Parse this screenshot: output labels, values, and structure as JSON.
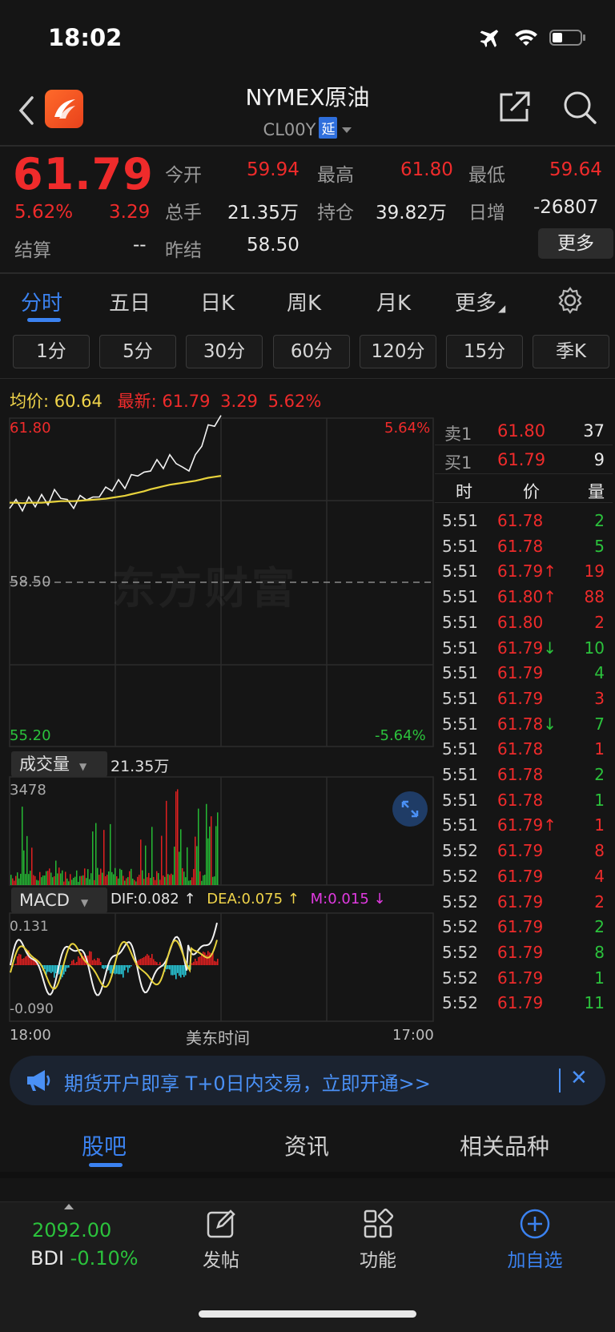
{
  "status": {
    "time": "18:02"
  },
  "header": {
    "title": "NYMEX原油",
    "code": "CL00Y",
    "badge": "延"
  },
  "quote": {
    "price": "61.79",
    "change_pct": "5.62%",
    "change": "3.29",
    "settle_label": "结算",
    "settle_value": "--",
    "fields": [
      {
        "label": "今开",
        "value": "59.94",
        "color": "red"
      },
      {
        "label": "最高",
        "value": "61.80",
        "color": "red"
      },
      {
        "label": "最低",
        "value": "59.64",
        "color": "red"
      },
      {
        "label": "总手",
        "value": "21.35万",
        "color": "white"
      },
      {
        "label": "持仓",
        "value": "39.82万",
        "color": "white"
      },
      {
        "label": "日增",
        "value": "-26807",
        "color": "white"
      },
      {
        "label": "昨结",
        "value": "58.50",
        "color": "white"
      }
    ],
    "more_label": "更多"
  },
  "main_tabs": [
    "分时",
    "五日",
    "日K",
    "周K",
    "月K",
    "更多"
  ],
  "period_tabs": [
    "1分",
    "5分",
    "30分",
    "60分",
    "120分",
    "15分",
    "季K"
  ],
  "avg_row": {
    "avg_label": "均价:",
    "avg_value": "60.64",
    "latest_label": "最新:",
    "latest_value": "61.79",
    "latest_change": "3.29",
    "latest_pct": "5.62%"
  },
  "chart": {
    "price_top": "61.80",
    "price_mid": "58.50",
    "price_bot": "55.20",
    "pct_top": "5.64%",
    "pct_bot": "-5.64%",
    "watermark": "东方财富",
    "volume_label": "成交量",
    "volume_total": "21.35万",
    "volume_max": "3478",
    "macd_label": "MACD",
    "dif": "DIF:0.082 ↑",
    "dea": "DEA:0.075 ↑",
    "m": "M:0.015 ↓",
    "macd_max": "0.131",
    "macd_min": "-0.090",
    "x_left": "18:00",
    "x_mid": "美东时间",
    "x_right": "17:00"
  },
  "chart_data": {
    "type": "line",
    "xlabel": "美东时间",
    "ylim": [
      55.2,
      61.8
    ],
    "series": [
      {
        "values": [
          60.05,
          60.1,
          60.0,
          60.15,
          60.08,
          60.2,
          60.12,
          60.3,
          60.25,
          60.1,
          60.05,
          60.18,
          60.22,
          60.15,
          60.28,
          60.35,
          60.4,
          60.5,
          60.45,
          60.6,
          60.7,
          60.65,
          60.8,
          60.9,
          60.85,
          61.0,
          60.95,
          60.75,
          60.8,
          61.0,
          61.3,
          61.6,
          61.7,
          61.79
        ]
      },
      {
        "values": [
          60.1,
          60.1,
          60.09,
          60.1,
          60.1,
          60.1,
          60.11,
          60.12,
          60.13,
          60.13,
          60.13,
          60.14,
          60.15,
          60.16,
          60.17,
          60.18,
          60.2,
          60.22,
          60.24,
          60.27,
          60.3,
          60.33,
          60.37,
          60.4,
          60.43,
          60.46,
          60.48,
          60.5,
          60.52,
          60.54,
          60.57,
          60.6,
          60.62,
          60.64
        ]
      }
    ]
  },
  "order_book": {
    "asks": [
      {
        "label": "卖1",
        "price": "61.80",
        "vol": "37"
      }
    ],
    "bids": [
      {
        "label": "买1",
        "price": "61.79",
        "vol": "9"
      }
    ],
    "headers": [
      "时",
      "价",
      "量"
    ],
    "ticks": [
      {
        "t": "5:51",
        "p": "61.78",
        "v": "2",
        "arrow": "",
        "vc": "green"
      },
      {
        "t": "5:51",
        "p": "61.78",
        "v": "5",
        "arrow": "",
        "vc": "green"
      },
      {
        "t": "5:51",
        "p": "61.79↑",
        "v": "19",
        "arrow": "",
        "vc": "red"
      },
      {
        "t": "5:51",
        "p": "61.80↑",
        "v": "88",
        "arrow": "",
        "vc": "red"
      },
      {
        "t": "5:51",
        "p": "61.80",
        "v": "2",
        "arrow": "",
        "vc": "red"
      },
      {
        "t": "5:51",
        "p": "61.79↓",
        "v": "10",
        "arrow": "",
        "vc": "green"
      },
      {
        "t": "5:51",
        "p": "61.79",
        "v": "4",
        "arrow": "",
        "vc": "green"
      },
      {
        "t": "5:51",
        "p": "61.79",
        "v": "3",
        "arrow": "",
        "vc": "red"
      },
      {
        "t": "5:51",
        "p": "61.78↓",
        "v": "7",
        "arrow": "",
        "vc": "green"
      },
      {
        "t": "5:51",
        "p": "61.78",
        "v": "1",
        "arrow": "",
        "vc": "red"
      },
      {
        "t": "5:51",
        "p": "61.78",
        "v": "2",
        "arrow": "",
        "vc": "green"
      },
      {
        "t": "5:51",
        "p": "61.78",
        "v": "1",
        "arrow": "",
        "vc": "green"
      },
      {
        "t": "5:51",
        "p": "61.79↑",
        "v": "1",
        "arrow": "",
        "vc": "red"
      },
      {
        "t": "5:52",
        "p": "61.79",
        "v": "8",
        "arrow": "",
        "vc": "red"
      },
      {
        "t": "5:52",
        "p": "61.79",
        "v": "4",
        "arrow": "",
        "vc": "red"
      },
      {
        "t": "5:52",
        "p": "61.79",
        "v": "2",
        "arrow": "",
        "vc": "red"
      },
      {
        "t": "5:52",
        "p": "61.79",
        "v": "2",
        "arrow": "",
        "vc": "green"
      },
      {
        "t": "5:52",
        "p": "61.79",
        "v": "8",
        "arrow": "",
        "vc": "green"
      },
      {
        "t": "5:52",
        "p": "61.79",
        "v": "1",
        "arrow": "",
        "vc": "green"
      },
      {
        "t": "5:52",
        "p": "61.79",
        "v": "11",
        "arrow": "",
        "vc": "green"
      }
    ]
  },
  "banner": {
    "text": "期货开户即享 T+0日内交易，立即开通>>",
    "close": "✕"
  },
  "lower_tabs": [
    "股吧",
    "资讯",
    "相关品种"
  ],
  "bottom_nav": {
    "bdi_value": "2092.00",
    "bdi_label": "BDI",
    "bdi_pct": "-0.10%",
    "items": [
      "发帖",
      "功能",
      "加自选"
    ]
  }
}
